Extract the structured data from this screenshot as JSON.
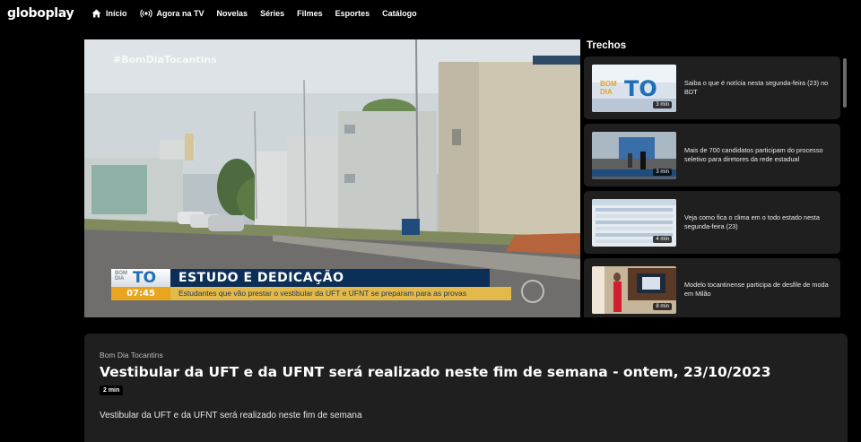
{
  "brand": {
    "logo": "globoplay"
  },
  "nav": [
    {
      "label": "Início",
      "icon": "home-icon"
    },
    {
      "label": "Agora na TV",
      "icon": "broadcast-icon"
    },
    {
      "label": "Novelas"
    },
    {
      "label": "Séries"
    },
    {
      "label": "Filmes"
    },
    {
      "label": "Esportes"
    },
    {
      "label": "Catálogo"
    }
  ],
  "player": {
    "hashtag": "#BomDiaTocantins",
    "logo_bom": "BOM",
    "logo_dia": "DIA",
    "logo_to": "TO",
    "time": "07:45",
    "headline": "ESTUDO E DEDICAÇÃO",
    "subline": "Estudantes que vão prestar o vestibular da UFT  e UFNT se preparam para as provas"
  },
  "trechos": {
    "title": "Trechos",
    "items": [
      {
        "text": "Saiba o que é notícia nesta segunda-feira (23) no BDT",
        "duration": "3 min"
      },
      {
        "text": "Mais de 700 candidatos participam do processo seletivo para diretores da rede estadual",
        "duration": "3 min"
      },
      {
        "text": "Veja como fica o clima em o todo estado nesta segunda-feira (23)",
        "duration": "4 min"
      },
      {
        "text": "Modelo tocantinense participa de desfile de moda em Milão",
        "duration": "8 min"
      }
    ]
  },
  "video": {
    "program": "Bom Dia Tocantins",
    "title": "Vestibular da UFT e da UFNT será realizado neste fim de semana - ontem, 23/10/2023",
    "duration": "2 min",
    "description": "Vestibular da UFT e da UFNT será realizado neste fim de semana"
  },
  "colors": {
    "background": "#000000",
    "card": "#1f1f1f",
    "accent_orange": "#e8a51d",
    "accent_navy": "#0c2f57"
  }
}
